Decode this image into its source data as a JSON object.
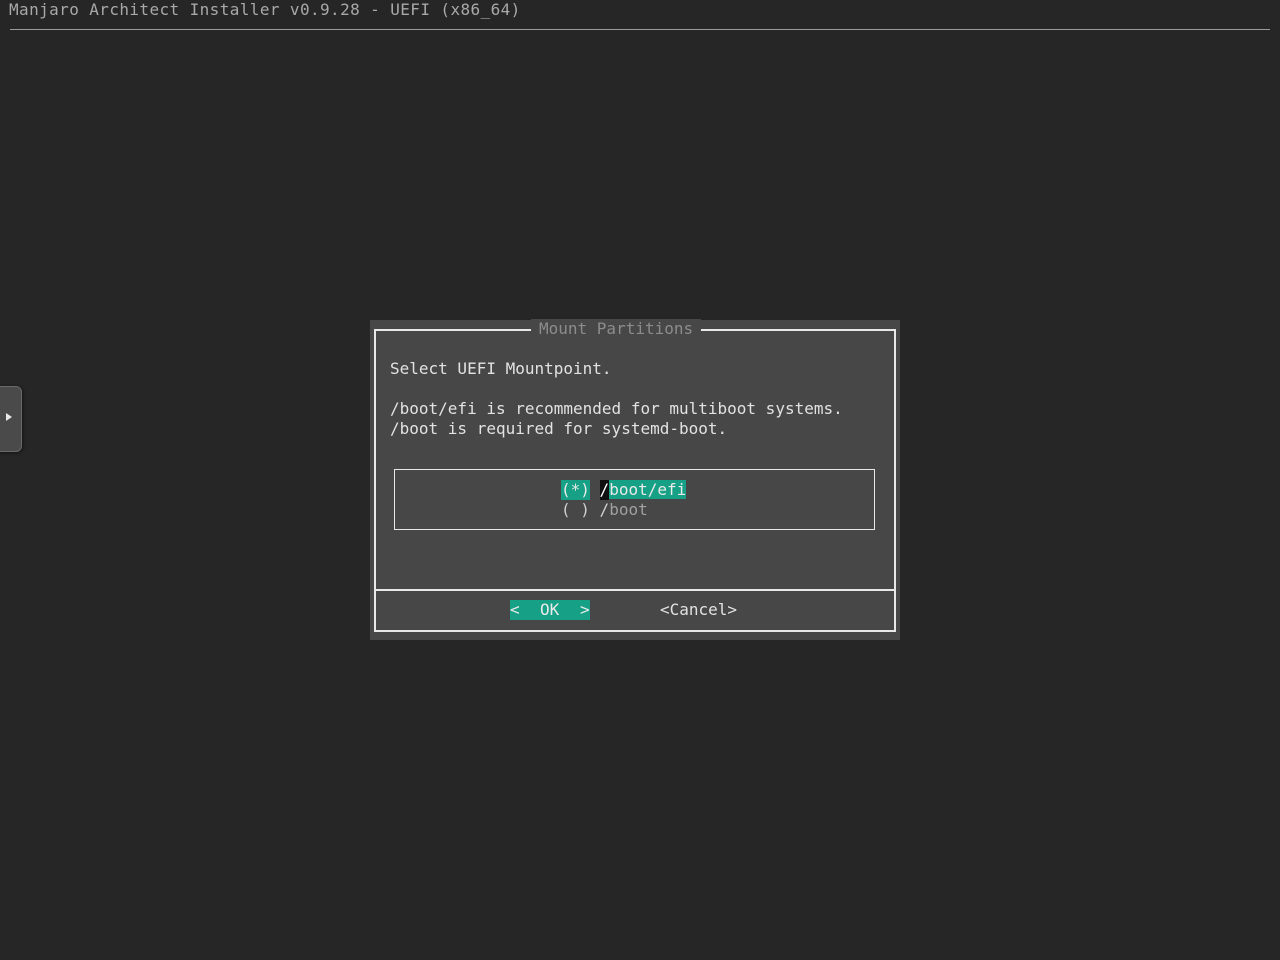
{
  "app": {
    "backtitle": "Manjaro Architect Installer v0.9.28 - UEFI (x86_64)"
  },
  "side_tab": {
    "icon": "triangle-right-icon"
  },
  "dialog": {
    "title": "Mount Partitions",
    "prompt": "Select UEFI Mountpoint.",
    "description_lines": [
      "/boot/efi is recommended for multiboot systems.",
      "/boot is required for systemd-boot."
    ],
    "options": [
      {
        "radio": "(*)",
        "slash": "/",
        "rest": "boot/efi",
        "selected": true
      },
      {
        "radio": "( )",
        "slash": "/",
        "rest": "boot",
        "selected": false
      }
    ],
    "buttons": {
      "ok_left": "<",
      "ok_label": "OK",
      "ok_right": ">",
      "cancel_label": "<Cancel>"
    }
  },
  "colors": {
    "background": "#262626",
    "dialog_bg": "#474747",
    "highlight": "#16a085"
  }
}
